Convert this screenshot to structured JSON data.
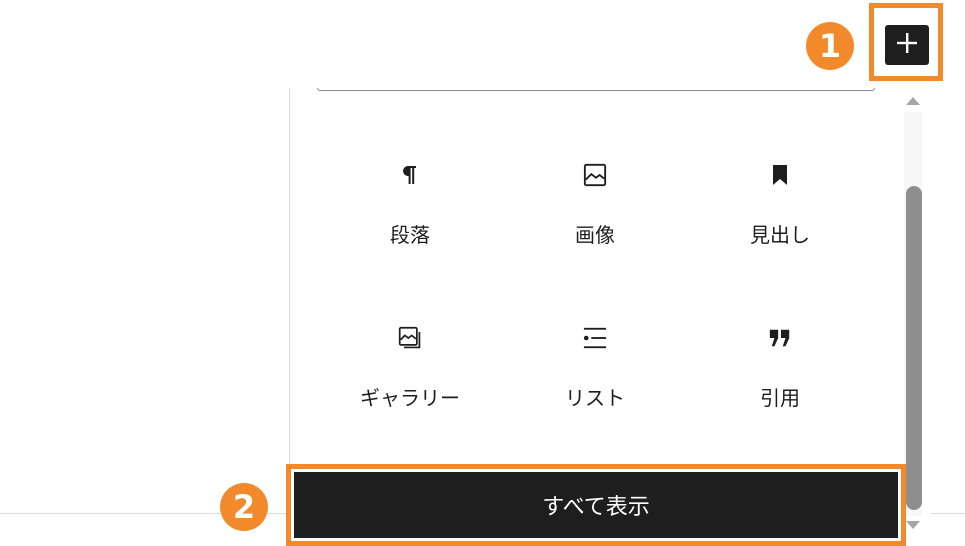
{
  "markers": {
    "one": "1",
    "two": "2"
  },
  "add_button": {
    "icon": "plus-icon",
    "color": "#1e1e1e"
  },
  "blocks": [
    {
      "label": "段落",
      "icon": "paragraph-icon"
    },
    {
      "label": "画像",
      "icon": "image-icon"
    },
    {
      "label": "見出し",
      "icon": "heading-bookmark-icon"
    },
    {
      "label": "ギャラリー",
      "icon": "gallery-icon"
    },
    {
      "label": "リスト",
      "icon": "list-icon"
    },
    {
      "label": "引用",
      "icon": "quote-icon"
    }
  ],
  "show_all": {
    "label": "すべて表示"
  },
  "colors": {
    "accent": "#f28a2b",
    "dark": "#1e1e1e",
    "scrollbar": "#8e8e8e"
  }
}
